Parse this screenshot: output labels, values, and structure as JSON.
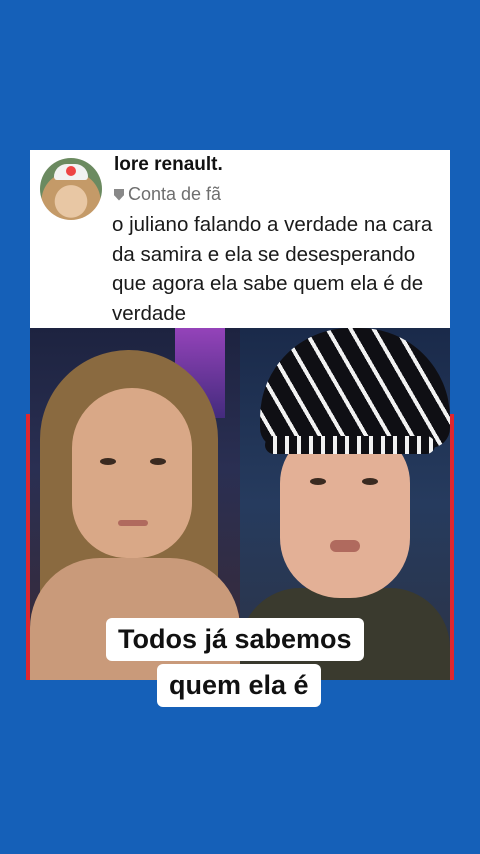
{
  "tweet": {
    "display_name": "lore renault.",
    "badge_label": "Conta de fã",
    "badge_icon": "shield-icon",
    "text": "o juliano falando a verdade na cara da samira e ela se desesperando que agora ela sabe quem ela é de verdade"
  },
  "caption": {
    "line1": "Todos já sabemos",
    "line2": "quem ela é"
  },
  "colors": {
    "background": "#1560b8",
    "frame_accent": "#e0262d"
  }
}
